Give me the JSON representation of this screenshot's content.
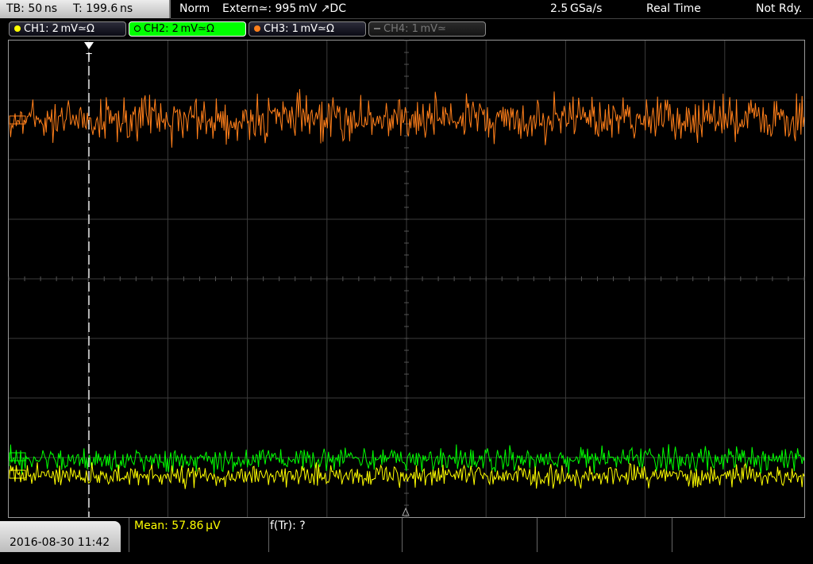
{
  "header": {
    "timebase": "TB: 50 ns",
    "trigger_time": "T: 199.6 ns",
    "acq_mode": "Norm",
    "trigger": "Extern≃: 995 mV ↗DC",
    "sample_rate": "2.5 GSa/s",
    "mode": "Real Time",
    "status": "Not Rdy."
  },
  "channels": [
    {
      "label": "CH1: 2 mV≃Ω",
      "color": "#ffff00",
      "active": false,
      "enabled": true
    },
    {
      "label": "CH2: 2 mV≃Ω",
      "color": "#00ff00",
      "active": true,
      "enabled": true
    },
    {
      "label": "CH3: 1 mV≃Ω",
      "color": "#ff7f1a",
      "active": false,
      "enabled": true
    },
    {
      "label": "CH4: 1 mV≃",
      "color": "#777777",
      "active": false,
      "enabled": false
    }
  ],
  "footer": {
    "datetime": "2016-08-30 11:42",
    "measurement_1": "Mean: 57.86 µV",
    "measurement_2": "f(Tr): ?"
  },
  "trigger_marker": "T",
  "colors": {
    "ch1": "#ffff00",
    "ch2": "#00ff00",
    "ch3": "#ff7f1a",
    "grid": "#3c3c3c",
    "accent_yellow": "#ffff00"
  }
}
